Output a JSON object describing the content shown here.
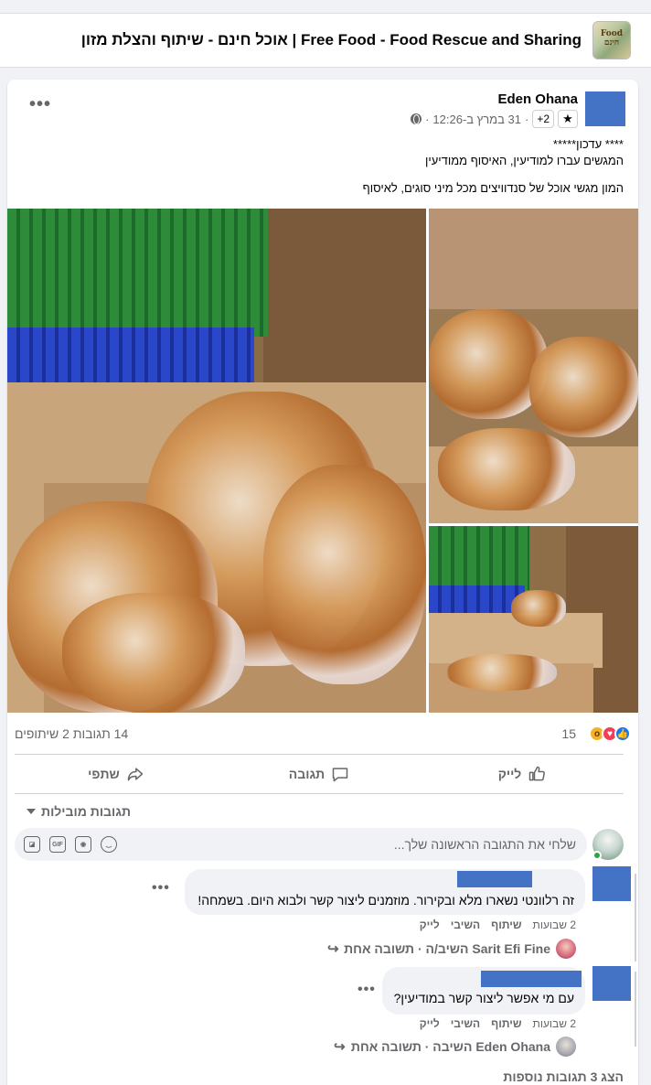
{
  "group": {
    "title": "אוכל חינם - שיתוף והצלת מזון | Free Food - Food Rescue and Sharing",
    "avatar_text": "Food חינם",
    "avatar_icon": "group-photo"
  },
  "post": {
    "author": "Eden Ohana",
    "badge_icon": "star-icon",
    "plus_badge": "+2",
    "timestamp": "31 במרץ ב-12:26",
    "separator": "·",
    "privacy_icon": "globe-icon",
    "more_label": "•••",
    "text_lines": [
      "**** עדכון*****",
      "המגשים עברו למודיעין, האיסוף ממודיעין",
      "המון מגשי אוכל של סנדוויצים מכל מיני סוגים, לאיסוף"
    ],
    "photos": [
      {
        "name": "photo-main",
        "alt": "sandwich-bags-in-box"
      },
      {
        "name": "photo-top-right",
        "alt": "sandwiches-close-up"
      },
      {
        "name": "photo-bottom-right",
        "alt": "stacked-boxes"
      }
    ]
  },
  "stats": {
    "reaction_icons": [
      "like-icon",
      "love-icon",
      "wow-icon"
    ],
    "reaction_count": "15",
    "comments_shares": "14 תגובות  2 שיתופים"
  },
  "actions": {
    "like": "לייק",
    "comment": "תגובה",
    "share": "שתפי"
  },
  "comments_section": {
    "filter_label": "תגובות מובילות",
    "composer_placeholder": "שלחי את התגובה הראשונה שלך...",
    "composer_icons": [
      "emoji-icon",
      "camera-icon",
      "gif-icon",
      "sticker-icon"
    ],
    "gif_label": "GIF",
    "comments": [
      {
        "text": "זה רלוונטי נשארו מלא ובקירור. מוזמנים ליצור קשר ולבוא היום. בשמחה!",
        "actions": [
          "לייק",
          "השיבי",
          "שיתוף"
        ],
        "time": "2 שבועות",
        "reply_summary": "Sarit Efi Fine השיב/ה · תשובה אחת"
      },
      {
        "text": "עם מי אפשר ליצור קשר במודיעין?",
        "actions": [
          "לייק",
          "השיבי",
          "שיתוף"
        ],
        "time": "2 שבועות",
        "reply_summary": "Eden Ohana השיבה · תשובה אחת"
      }
    ],
    "more_comments": "הצג 3 תגובות נוספות"
  },
  "colors": {
    "redaction_blue": "#4472c4",
    "like_blue": "#1877f2",
    "secondary_text": "#65676b"
  }
}
